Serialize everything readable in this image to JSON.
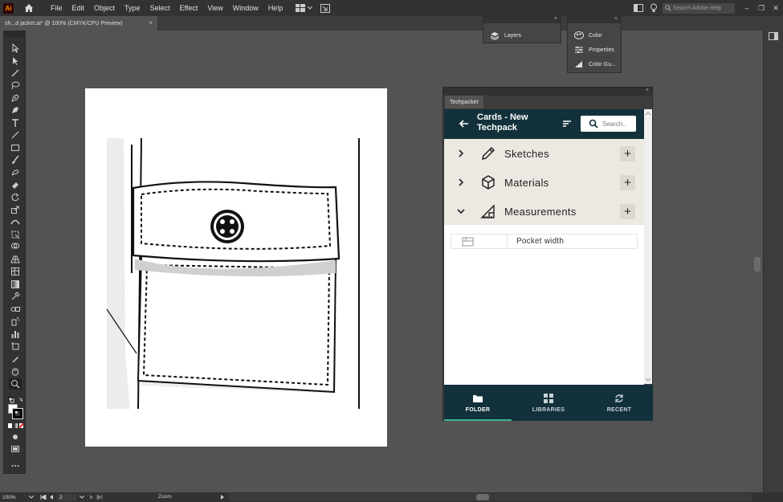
{
  "app": {
    "logo": "Ai",
    "menu": [
      "File",
      "Edit",
      "Object",
      "Type",
      "Select",
      "Effect",
      "View",
      "Window",
      "Help"
    ],
    "search_placeholder": "Search Adobe Help",
    "window_controls": [
      "–",
      "❐",
      "✕"
    ]
  },
  "document": {
    "tab_title": "sh...d jacket.ai* @ 100% (CMYK/CPU Preview)",
    "close_glyph": "×"
  },
  "floating_panels": {
    "layers": "Layers",
    "color": "Color",
    "properties": "Properties",
    "color_guide": "Color Gu..."
  },
  "techpacker": {
    "tab_label": "Techpacker",
    "title": "Cards - New Techpack",
    "search_placeholder": "Search..",
    "sections": [
      {
        "label": "Sketches",
        "icon": "pencil-icon",
        "expanded": false
      },
      {
        "label": "Materials",
        "icon": "cube-icon",
        "expanded": false
      },
      {
        "label": "Measurements",
        "icon": "ruler-icon",
        "expanded": true
      }
    ],
    "add_glyph": "+",
    "measurement_items": [
      "Pocket width"
    ],
    "footer": {
      "folder": "FOLDER",
      "libraries": "LIBRARIES",
      "recent": "RECENT",
      "active": "FOLDER"
    },
    "colors": {
      "header_bg": "#12313b",
      "section_bg": "#ece9e2",
      "active_underline": "#3db39a"
    }
  },
  "status": {
    "zoom": "100%",
    "page": "2",
    "label": "Zoom"
  }
}
